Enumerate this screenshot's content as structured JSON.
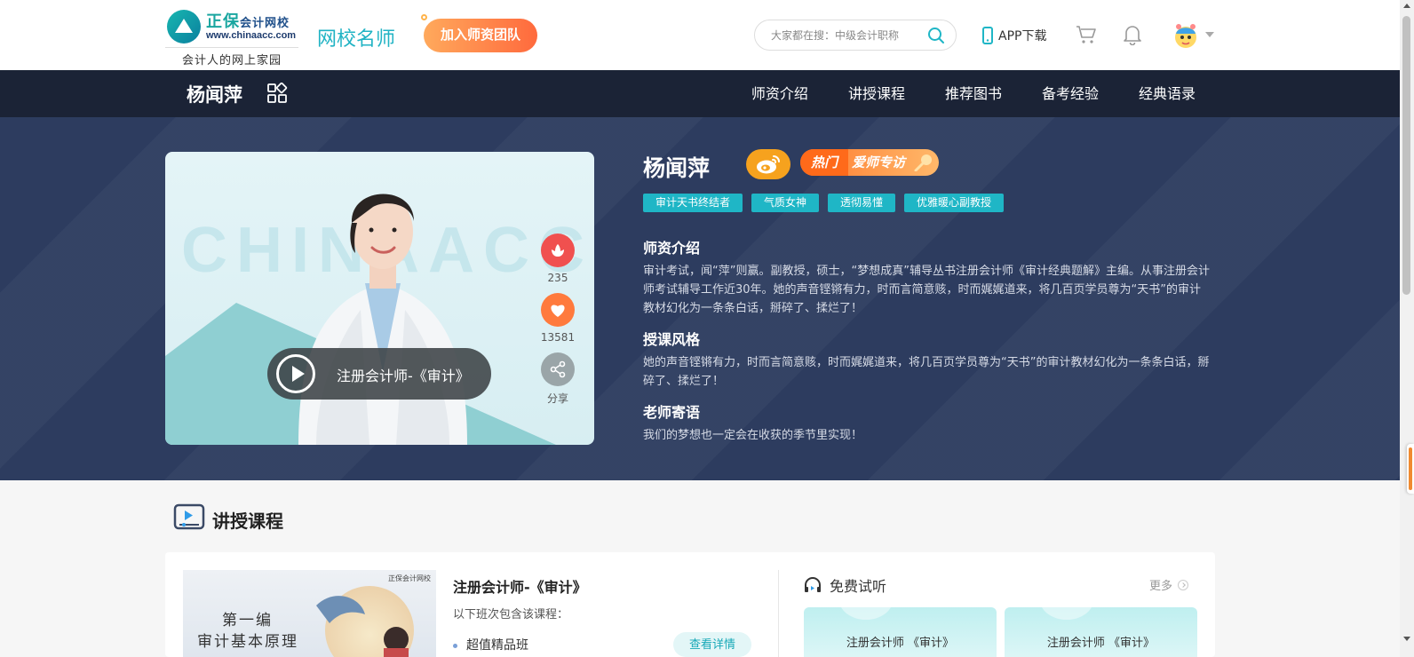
{
  "header": {
    "logo_brand": "正保",
    "logo_brand_sub": "会计网校",
    "logo_url": "www.chinaacc.com",
    "logo_slogan": "会计人的网上家园",
    "site_name": "网校名师",
    "join_label": "加入师资团队",
    "search_placeholder": "大家都在搜：中级会计职称",
    "app_download": "APP下载"
  },
  "navbar": {
    "teacher_name": "杨闻萍",
    "links": [
      "师资介绍",
      "讲授课程",
      "推荐图书",
      "备考经验",
      "经典语录"
    ]
  },
  "hero": {
    "watermark": "CHINAACC",
    "video_label": "注册会计师-《审计》",
    "flower_count": "235",
    "like_count": "13581",
    "share_label": "分享",
    "name": "杨闻萍",
    "hot_left": "热门",
    "hot_right": "爱师专访",
    "tags": [
      "审计天书终结者",
      "气质女神",
      "透彻易懂",
      "优雅暖心副教授"
    ],
    "sections": [
      {
        "title": "师资介绍",
        "body": "审计考试，闻“萍”则赢。副教授，硕士，“梦想成真”辅导丛书注册会计师《审计经典题解》主编。从事注册会计师考试辅导工作近30年。她的声音铿锵有力，时而言简意赅，时而娓娓道来，将几百页学员尊为“天书”的审计教材幻化为一条条白话，掰碎了、揉烂了！"
      },
      {
        "title": "授课风格",
        "body": "她的声音铿锵有力，时而言简意赅，时而娓娓道来，将几百页学员尊为“天书”的审计教材幻化为一条条白话，掰碎了、揉烂了！"
      },
      {
        "title": "老师寄语",
        "body": "我们的梦想也一定会在收获的季节里实现！"
      }
    ]
  },
  "courses": {
    "section_title": "讲授课程",
    "card": {
      "thumb_logo": "正保会计网校",
      "thumb_line1": "第一编",
      "thumb_line2": "审计基本原理",
      "name": "注册会计师-《审计》",
      "subtitle": "以下班次包含该课程：",
      "class_item": "超值精品班",
      "detail_label": "查看详情",
      "free_title": "免费试听",
      "more_label": "更多",
      "trials": [
        "注册会计师 《审计》",
        "注册会计师 《审计》"
      ]
    }
  },
  "colors": {
    "accent": "#1fb6c6",
    "navbar": "#1b2336",
    "hero_bg": "#2d3c5f",
    "join_start": "#ffa95c",
    "join_end": "#ff6a3d"
  }
}
